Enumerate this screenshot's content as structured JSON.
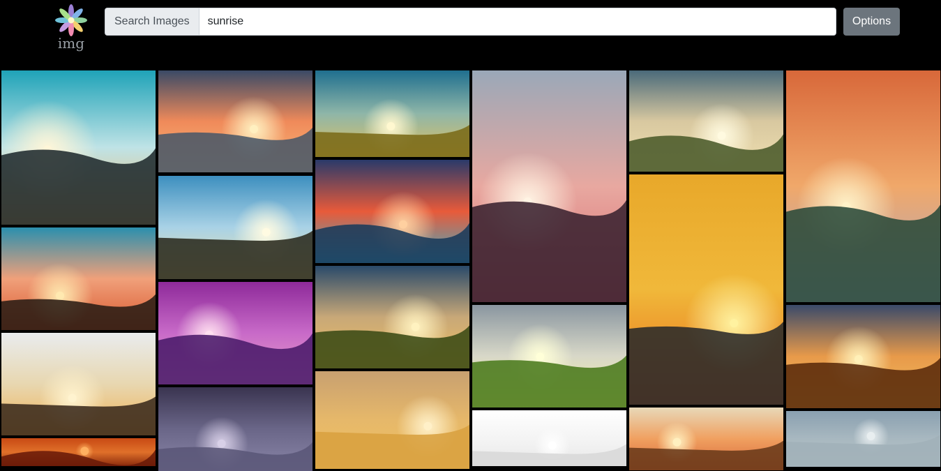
{
  "header": {
    "logo_text": "img",
    "search": {
      "label": "Search Images",
      "value": "sunrise"
    },
    "options_label": "Options"
  },
  "gallery": {
    "columns": [
      [
        {
          "name": "sunrise-mountain-grass",
          "sky": [
            "#1fa3b8",
            "#bfe3e6",
            "#f5b35a"
          ],
          "ground": "#1f2a2e",
          "sun": "#fff6d8"
        },
        {
          "name": "sunrise-branches-silhouette",
          "sky": [
            "#2a8fae",
            "#f0a07a",
            "#d9582f"
          ],
          "ground": "#2a1c14",
          "sun": "#ffe9b0"
        },
        {
          "name": "sunrise-above-clouds",
          "sky": [
            "#e9ecee",
            "#e8d7b0",
            "#f0b052"
          ],
          "ground": "#3a2a1c",
          "sun": "#fff3cf"
        },
        {
          "name": "sunrise-desert-dunes",
          "sky": [
            "#c84a14",
            "#e0702a",
            "#8a2a0c"
          ],
          "ground": "#6a1a08",
          "sun": "#ffb060"
        }
      ],
      [
        {
          "name": "sunrise-sea-clouds",
          "sky": [
            "#3a4a66",
            "#f08a5a",
            "#f7b97a"
          ],
          "ground": "#4a5868",
          "sun": "#fff0c0"
        },
        {
          "name": "person-arms-open-sunrise",
          "sky": [
            "#3d8fbf",
            "#a9d2e6",
            "#f0e2a8"
          ],
          "ground": "#2a2a1e",
          "sun": "#fffbe2"
        },
        {
          "name": "purple-beach-waves",
          "sky": [
            "#8e2a9a",
            "#c86ac8",
            "#e8a0c8"
          ],
          "ground": "#4a1a6a",
          "sun": "#ffe0f0"
        },
        {
          "name": "hazy-purple-sky",
          "sky": [
            "#3a3450",
            "#6a6688",
            "#8a86a8"
          ],
          "ground": "#5a5678",
          "sun": "#d8d0e8"
        }
      ],
      [
        {
          "name": "sunrise-golden-field",
          "sky": [
            "#1f6f8f",
            "#8fb6a8",
            "#e0c060"
          ],
          "ground": "#7a6a18",
          "sun": "#fff8d0"
        },
        {
          "name": "reflection-lake-silhouette",
          "sky": [
            "#2a3a6a",
            "#e85a3a",
            "#3ab0c8"
          ],
          "ground": "#1a3a5a",
          "sun": "#ffd0a0"
        },
        {
          "name": "misty-valley-trees",
          "sky": [
            "#2a4a6a",
            "#c8a878",
            "#f0c060"
          ],
          "ground": "#3a4a14",
          "sun": "#fff2c0"
        },
        {
          "name": "golden-haze-sky",
          "sky": [
            "#c8a070",
            "#e6b86a",
            "#f0c060"
          ],
          "ground": "#d8a040",
          "sun": "#fff0c8"
        }
      ],
      [
        {
          "name": "pink-sunrise-mountains",
          "sky": [
            "#9aa8b8",
            "#e8a8a0",
            "#d86a70"
          ],
          "ground": "#3a2230",
          "sun": "#fff4e4"
        },
        {
          "name": "lone-tree-sunrise",
          "sky": [
            "#8a96a0",
            "#d8d8c8",
            "#f8f0a0"
          ],
          "ground": "#4a7a1c",
          "sun": "#ffffd8"
        },
        {
          "name": "bright-white-sky",
          "sky": [
            "#ffffff",
            "#f4f4f4",
            "#e8e8e8"
          ],
          "ground": "#d8d8d8",
          "sun": "#ffffff"
        }
      ],
      [
        {
          "name": "rocky-mountain-sunrise",
          "sky": [
            "#4a6a7a",
            "#d8c8a0",
            "#f0e0b0"
          ],
          "ground": "#4a5a2a",
          "sun": "#fffae0"
        },
        {
          "name": "sea-sunrise-waves",
          "sky": [
            "#e8a82a",
            "#f0b83a",
            "#e86a1a"
          ],
          "ground": "#2a2a2a",
          "sun": "#fff2a0"
        },
        {
          "name": "rock-formation-sunrise",
          "sky": [
            "#e8d8b8",
            "#f0a060",
            "#d8683a"
          ],
          "ground": "#6a3a1a",
          "sun": "#fff0c0"
        }
      ],
      [
        {
          "name": "wild-grass-sunrise",
          "sky": [
            "#d8683a",
            "#f0a86a",
            "#a8a8c8"
          ],
          "ground": "#2a4a3a",
          "sun": "#fff2c8"
        },
        {
          "name": "autumn-valley-sunrise",
          "sky": [
            "#3a4a6a",
            "#e89a4a",
            "#f0c060"
          ],
          "ground": "#5a2a0a",
          "sun": "#fff0b8"
        },
        {
          "name": "pale-blue-sky",
          "sky": [
            "#8aa0b0",
            "#a8b8c0",
            "#b8c4c8"
          ],
          "ground": "#a0b0b8",
          "sun": "#e8eef0"
        }
      ]
    ]
  }
}
